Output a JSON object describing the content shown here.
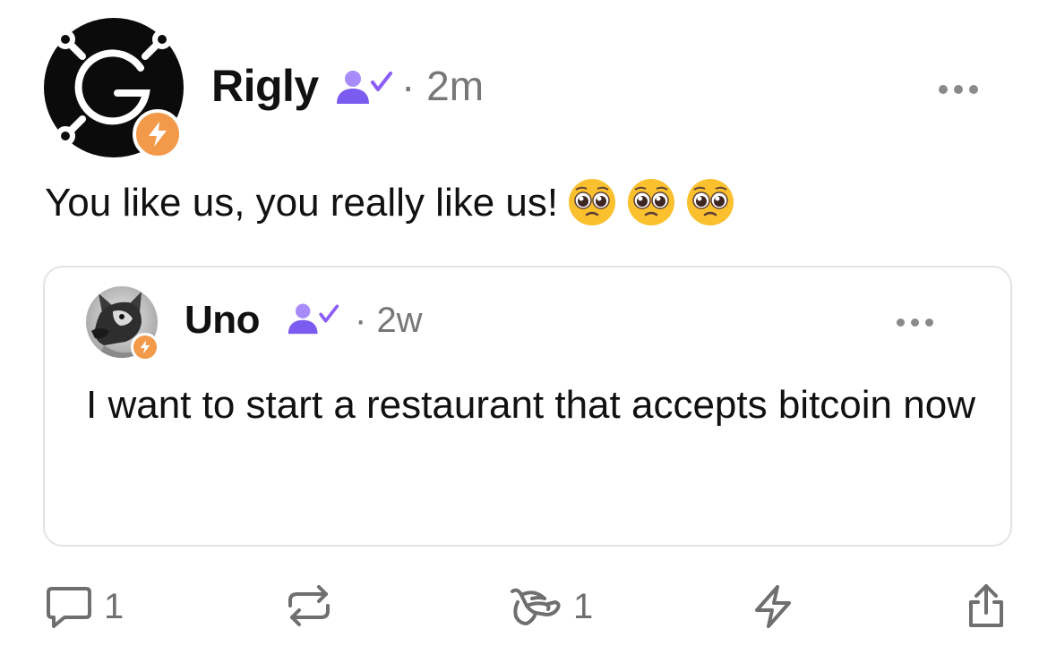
{
  "post": {
    "author": "Rigly",
    "time": "2m",
    "text": "You like us, you really like us!",
    "emoji": [
      "pleading-face",
      "pleading-face",
      "pleading-face"
    ]
  },
  "quote": {
    "author": "Uno",
    "time": "2w",
    "text": "I want to start a restaurant that accepts bitcoin now"
  },
  "actions": {
    "reply_count": "1",
    "like_count": "1"
  },
  "icons": [
    "lightning-bolt-icon",
    "verified-user-icon",
    "more-options-icon",
    "reply-icon",
    "repost-icon",
    "shaka-icon",
    "zap-icon",
    "share-icon"
  ],
  "colors": {
    "verified": "#8b5cf6",
    "zap_badge": "#f2994a",
    "meta_text": "#777777",
    "border": "#e3e3e3"
  }
}
